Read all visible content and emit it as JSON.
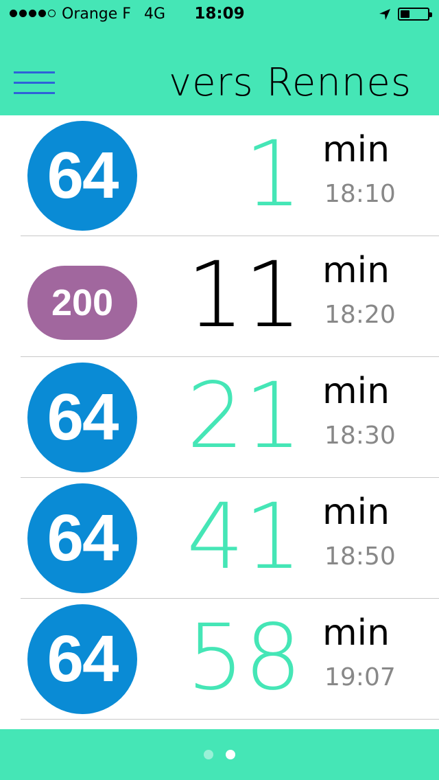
{
  "status_bar": {
    "carrier": "Orange F",
    "network": "4G",
    "time": "18:09",
    "signal_bars_filled": 4,
    "signal_bars_total": 5,
    "battery_level": 0.35
  },
  "header": {
    "title": "vers Rennes",
    "menu_icon": "hamburger-menu-icon"
  },
  "colors": {
    "accent": "#45E6B6",
    "line_64": "#0A8BD5",
    "line_200": "#A1679E",
    "menu": "#2E62D8",
    "eta_gray": "#888888"
  },
  "departures": [
    {
      "line": "64",
      "minutes": "1",
      "unit": "min",
      "time": "18:10",
      "highlight": true
    },
    {
      "line": "200",
      "minutes": "11",
      "unit": "min",
      "time": "18:20",
      "highlight": false
    },
    {
      "line": "64",
      "minutes": "21",
      "unit": "min",
      "time": "18:30",
      "highlight": true
    },
    {
      "line": "64",
      "minutes": "41",
      "unit": "min",
      "time": "18:50",
      "highlight": true
    },
    {
      "line": "64",
      "minutes": "58",
      "unit": "min",
      "time": "19:07",
      "highlight": true
    }
  ],
  "pager": {
    "pages": 2,
    "current": 2
  }
}
